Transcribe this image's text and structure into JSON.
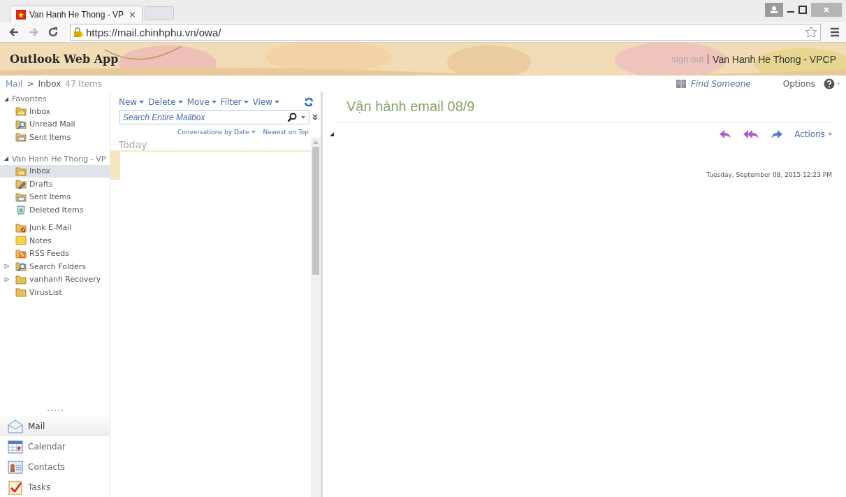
{
  "browser": {
    "tab_title": "Van Hanh He Thong - VP",
    "tab_close": "×",
    "address": "https://mail.chinhphu.vn/owa/"
  },
  "header": {
    "logo": "Outlook Web App",
    "sign_out": "sign out",
    "user": "Van Hanh He Thong - VPCP"
  },
  "breadcrumb": {
    "root": "Mail",
    "separator": ">",
    "folder": "Inbox",
    "count": "47 Items"
  },
  "top_links": {
    "find_someone": "Find Someone",
    "options": "Options"
  },
  "navigation": {
    "groups": [
      {
        "label": "Favorites",
        "expanded": true,
        "items": [
          {
            "label": "Inbox",
            "kind": "inbox",
            "selected": false
          },
          {
            "label": "Unread Mail",
            "kind": "search",
            "selected": false
          },
          {
            "label": "Sent Items",
            "kind": "sent",
            "selected": false
          }
        ]
      },
      {
        "label": "Van Hanh He Thong - VP",
        "expanded": true,
        "items": [
          {
            "label": "Inbox",
            "kind": "inbox",
            "selected": true
          },
          {
            "label": "Drafts",
            "kind": "drafts",
            "selected": false
          },
          {
            "label": "Sent Items",
            "kind": "sent",
            "selected": false
          },
          {
            "label": "Deleted Items",
            "kind": "deleted",
            "selected": false,
            "gap_after": true
          },
          {
            "label": "Junk E-Mail",
            "kind": "junk",
            "selected": false
          },
          {
            "label": "Notes",
            "kind": "notes",
            "selected": false
          },
          {
            "label": "RSS Feeds",
            "kind": "rss",
            "selected": false
          },
          {
            "label": "Search Folders",
            "kind": "search",
            "selected": false,
            "expanded": false
          },
          {
            "label": "vanhanh Recovery",
            "kind": "folder",
            "selected": false,
            "expanded": false
          },
          {
            "label": "VirusList",
            "kind": "folder",
            "selected": false
          }
        ]
      }
    ]
  },
  "modules": [
    {
      "label": "Mail",
      "kind": "mail",
      "selected": true
    },
    {
      "label": "Calendar",
      "kind": "calendar",
      "selected": false
    },
    {
      "label": "Contacts",
      "kind": "contacts",
      "selected": false
    },
    {
      "label": "Tasks",
      "kind": "tasks",
      "selected": false
    }
  ],
  "toolbar": [
    "New",
    "Delete",
    "Move",
    "Filter",
    "View"
  ],
  "search": {
    "placeholder": "Search Entire Mailbox"
  },
  "sort": {
    "arrange": "Conversations by Date",
    "order": "Newest on Top"
  },
  "message_list": {
    "group": "Today"
  },
  "reading_pane": {
    "subject": "Vận hành email 08/9",
    "actions": "Actions",
    "date": "Tuesday, September 08, 2015 12:23 PM"
  }
}
